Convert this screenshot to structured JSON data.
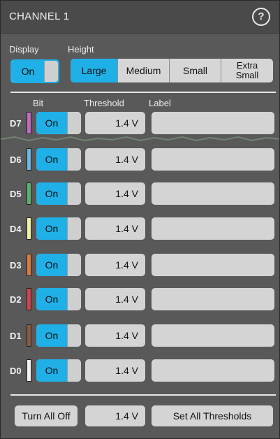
{
  "title": "CHANNEL 1",
  "help_glyph": "?",
  "display": {
    "label": "Display",
    "value": "On"
  },
  "height": {
    "label": "Height",
    "options": [
      "Large",
      "Medium",
      "Small",
      "Extra Small"
    ],
    "extra_line1": "Extra",
    "extra_line2": "Small",
    "selected": "Large"
  },
  "columns": {
    "bit": "Bit",
    "threshold": "Threshold",
    "label": "Label"
  },
  "channels": [
    {
      "name": "D7",
      "color": "#c46ac4",
      "state": "On",
      "threshold": "1.4 V",
      "label": ""
    },
    {
      "name": "D6",
      "color": "#6ab9e8",
      "state": "On",
      "threshold": "1.4 V",
      "label": ""
    },
    {
      "name": "D5",
      "color": "#59b26a",
      "state": "On",
      "threshold": "1.4 V",
      "label": ""
    },
    {
      "name": "D4",
      "color": "#f5f2a6",
      "state": "On",
      "threshold": "1.4 V",
      "label": ""
    },
    {
      "name": "D3",
      "color": "#e07a3a",
      "state": "On",
      "threshold": "1.4 V",
      "label": ""
    },
    {
      "name": "D2",
      "color": "#d8404a",
      "state": "On",
      "threshold": "1.4 V",
      "label": ""
    },
    {
      "name": "D1",
      "color": "#8a5a3a",
      "state": "On",
      "threshold": "1.4 V",
      "label": ""
    },
    {
      "name": "D0",
      "color": "#f4f4f4",
      "state": "On",
      "threshold": "1.4 V",
      "label": ""
    }
  ],
  "footer": {
    "turn_all_off": "Turn All Off",
    "threshold": "1.4 V",
    "set_all": "Set All Thresholds"
  },
  "colors": {
    "accent": "#1fb0e8",
    "panel": "#595959"
  }
}
